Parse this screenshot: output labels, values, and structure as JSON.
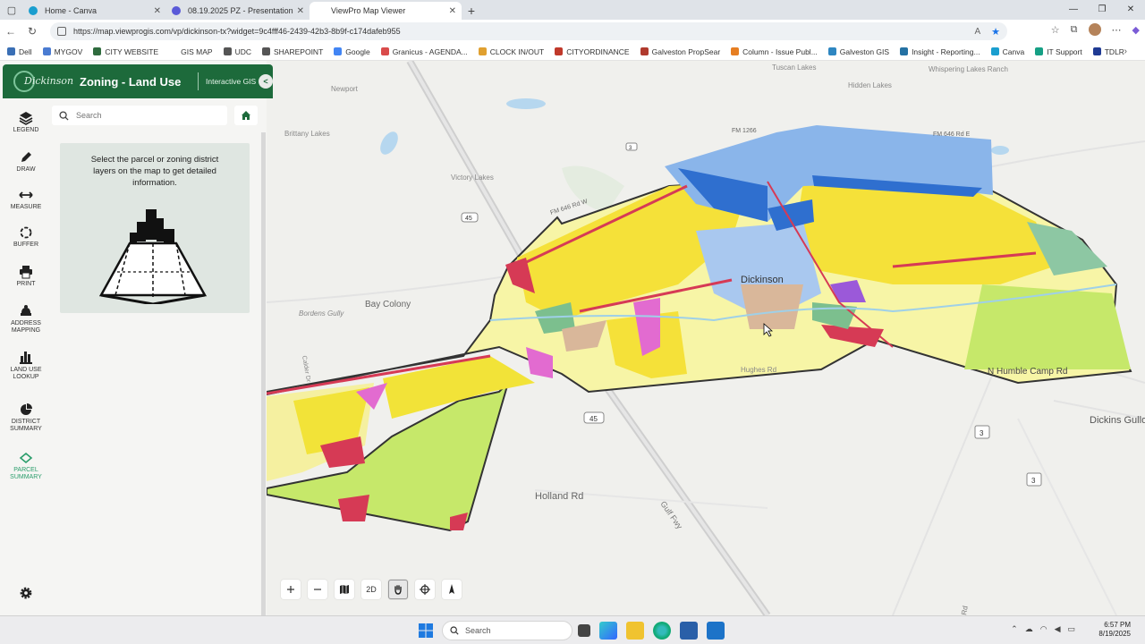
{
  "browser": {
    "tabs": [
      {
        "label": "Home - Canva",
        "favicon_color": "#1a9ecf",
        "active": false
      },
      {
        "label": "08.19.2025 PZ - Presentation",
        "favicon_color": "#5a5ad8",
        "active": false
      },
      {
        "label": "ViewPro Map Viewer",
        "favicon_color": "#ffffff",
        "active": true
      }
    ],
    "url": "https://map.viewprogis.com/vp/dickinson-tx?widget=9c4fff46-2439-42b3-8b9f-c174dafeb955",
    "bookmarks": [
      {
        "label": "Dell",
        "color": "#3a6fb5"
      },
      {
        "label": "MYGOV",
        "color": "#4a7bd1"
      },
      {
        "label": "CITY WEBSITE",
        "color": "#2f6b3e"
      },
      {
        "label": "GIS MAP",
        "color": "#ffffff"
      },
      {
        "label": "UDC",
        "color": "#555555"
      },
      {
        "label": "SHAREPOINT",
        "color": "#555555"
      },
      {
        "label": "Google",
        "color": "#4285f4"
      },
      {
        "label": "Granicus - AGENDA...",
        "color": "#d94b4b"
      },
      {
        "label": "CLOCK IN/OUT",
        "color": "#e0a030"
      },
      {
        "label": "CITYORDINANCE",
        "color": "#c0392b"
      },
      {
        "label": "Galveston PropSear",
        "color": "#b03a2e"
      },
      {
        "label": "Column - Issue Publ...",
        "color": "#e67e22"
      },
      {
        "label": "Galveston GIS",
        "color": "#2e86c1"
      },
      {
        "label": "Insight - Reporting...",
        "color": "#2471a3"
      },
      {
        "label": "Canva",
        "color": "#1a9ecf"
      },
      {
        "label": "IT Support",
        "color": "#16a085"
      },
      {
        "label": "TDLR",
        "color": "#1f3a93"
      }
    ]
  },
  "app": {
    "title": "Zoning - Land Use",
    "subtitle": "Interactive GIS",
    "logo_text": "Dickinson",
    "search_placeholder": "Search",
    "info_text": "Select the parcel or zoning district layers on the map to get detailed information.",
    "tools": [
      {
        "label": "LEGEND",
        "icon": "layers-icon",
        "active": false
      },
      {
        "label": "DRAW",
        "icon": "pencil-icon",
        "active": false
      },
      {
        "label": "MEASURE",
        "icon": "measure-icon",
        "active": false
      },
      {
        "label": "BUFFER",
        "icon": "buffer-icon",
        "active": false
      },
      {
        "label": "PRINT",
        "icon": "printer-icon",
        "active": false
      },
      {
        "label": "ADDRESS MAPPING",
        "icon": "address-icon",
        "active": false
      },
      {
        "label": "LAND USE LOOKUP",
        "icon": "land-use-icon",
        "active": false
      },
      {
        "label": "DISTRICT SUMMARY",
        "icon": "pie-icon",
        "active": false
      },
      {
        "label": "PARCEL SUMMARY",
        "icon": "parcel-icon",
        "active": true
      }
    ],
    "map_tool_2d": "2D"
  },
  "map": {
    "labels": {
      "newport": "Newport",
      "brittany": "Brittany Lakes",
      "victory": "Victory Lakes",
      "bay_colony": "Bay Colony",
      "bordens": "Bordens Gully",
      "dickinson": "Dickinson",
      "tuscan": "Tuscan Lakes",
      "hidden": "Hidden Lakes",
      "whispering": "Whispering Lakes Ranch",
      "holland": "Holland Rd",
      "humble": "N Humble Camp Rd",
      "gulf": "Gulf Fwy",
      "hughes": "Hughes Rd",
      "fm646": "FM 646 Rd W",
      "fm646e": "FM 646 Rd E",
      "fm1266": "FM 1266",
      "caldor": "Calder Dr",
      "dickinson_right": "Dickins Gullo Oil F",
      "shield_45": "45",
      "shield_3": "3",
      "hwy_3": "3",
      "road_right": "Rd"
    }
  },
  "taskbar": {
    "search_placeholder": "Search",
    "time": "6:57 PM",
    "date": "8/19/2025"
  }
}
